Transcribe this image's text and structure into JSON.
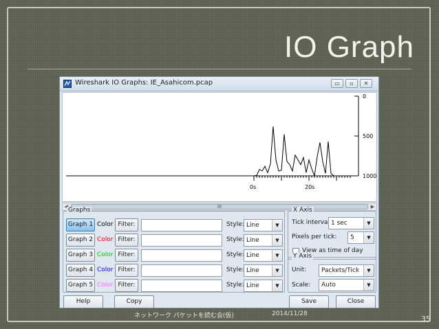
{
  "slide": {
    "title": "IO Graph",
    "footer_left": "ネットワーク パケットを読む会(仮)",
    "footer_date": "2014/11/28",
    "page_number": "35"
  },
  "window": {
    "title": "Wireshark IO Graphs: IE_Asahicom.pcap",
    "min_label": "▭",
    "max_label": "▫",
    "close_label": "✕"
  },
  "plot": {
    "y_ticks": [
      "1000",
      "500",
      "0"
    ],
    "x_ticks": [
      "0s",
      "20s"
    ],
    "scroll_thumb": "III"
  },
  "chart_data": {
    "type": "line",
    "x": [
      0,
      1,
      2,
      3,
      4,
      5,
      6,
      7,
      8,
      9,
      10,
      11,
      12,
      13,
      14,
      15,
      16,
      17,
      18,
      19,
      20,
      21,
      22,
      23,
      24,
      25,
      26,
      27,
      28,
      29,
      30,
      31,
      32,
      33,
      34,
      35
    ],
    "series": [
      {
        "values": [
          0,
          5,
          80,
          60,
          120,
          40,
          150,
          620,
          200,
          60,
          70,
          520,
          180,
          140,
          60,
          260,
          200,
          140,
          230,
          40,
          200,
          90,
          0,
          240,
          420,
          180,
          30,
          430,
          30,
          0,
          0,
          0,
          0,
          0,
          0,
          0
        ]
      }
    ],
    "ylim": [
      0,
      1000
    ],
    "yticks": [
      0,
      500,
      1000
    ],
    "xticks": [
      "0s",
      "20s"
    ],
    "grid": false
  },
  "graphs": {
    "legend": "Graphs",
    "color_label": "Color",
    "filter_label": "Filter:",
    "style_label": "Style:",
    "rows": [
      {
        "button": "Graph 1",
        "color": "#000000",
        "style": "Line",
        "active": true
      },
      {
        "button": "Graph 2",
        "color": "#ff0000",
        "style": "Line",
        "active": false
      },
      {
        "button": "Graph 3",
        "color": "#00cc00",
        "style": "Line",
        "active": false
      },
      {
        "button": "Graph 4",
        "color": "#0000ff",
        "style": "Line",
        "active": false
      },
      {
        "button": "Graph 5",
        "color": "#ff66ff",
        "style": "Line",
        "active": false
      }
    ]
  },
  "xaxis": {
    "legend": "X Axis",
    "tick_interval_label": "Tick interval:",
    "tick_interval_value": "1 sec",
    "pixels_per_tick_label": "Pixels per tick:",
    "pixels_per_tick_value": "5",
    "view_time_label": "View as time of day"
  },
  "yaxis": {
    "legend": "Y Axis",
    "unit_label": "Unit:",
    "unit_value": "Packets/Tick",
    "scale_label": "Scale:",
    "scale_value": "Auto"
  },
  "buttons": {
    "help": "Help",
    "copy": "Copy",
    "save": "Save",
    "close": "Close"
  },
  "icons": {
    "dropdown": "▼"
  }
}
